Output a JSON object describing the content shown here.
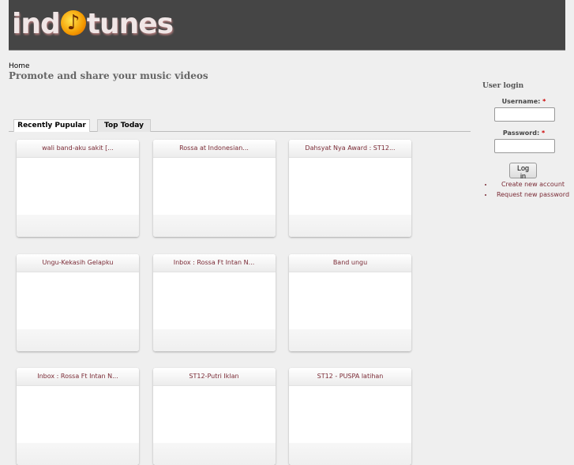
{
  "header": {
    "logo_text": "indotunes"
  },
  "breadcrumb": "Home",
  "slogan": "Promote and share your music videos",
  "tabs": [
    "Recently Pupular",
    "Top Today"
  ],
  "videos": [
    "wali band-aku sakit [...",
    "Rossa at Indonesian...",
    "Dahsyat Nya Award : ST12...",
    "Ungu-Kekasih Gelapku",
    "Inbox : Rossa Ft Intan N...",
    "Band ungu",
    "Inbox : Rossa Ft Intan N...",
    "ST12-Putri Iklan",
    "ST12 - PUSPA latihan"
  ],
  "login": {
    "title": "User login",
    "username_label": "Username:",
    "password_label": "Password:",
    "required": "*",
    "submit": "Log in",
    "links": [
      "Create new account",
      "Request new password"
    ]
  }
}
